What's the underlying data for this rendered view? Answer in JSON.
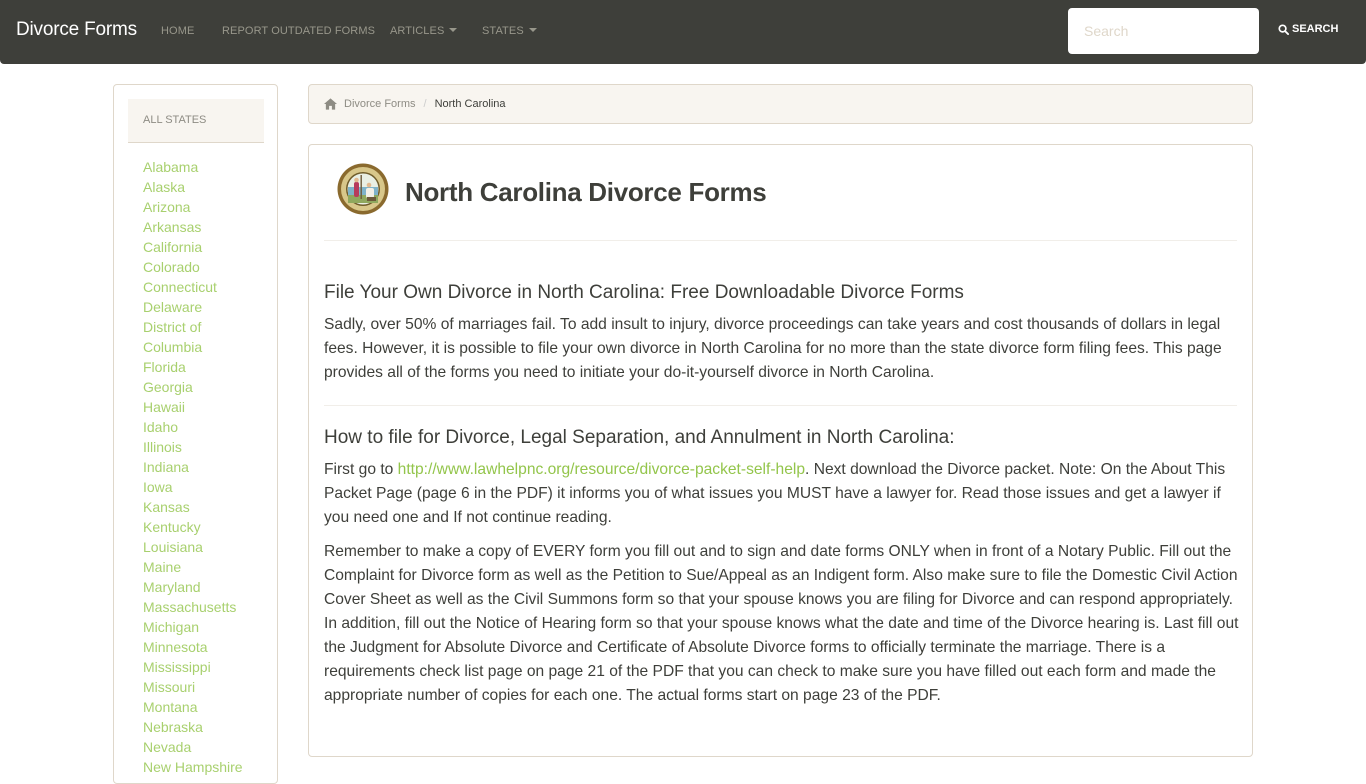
{
  "navbar": {
    "brand": "Divorce Forms",
    "items": [
      {
        "label": "Home",
        "dropdown": false
      },
      {
        "label": "Report Outdated Forms",
        "dropdown": false
      },
      {
        "label": "Articles",
        "dropdown": true
      },
      {
        "label": "States",
        "dropdown": true
      }
    ],
    "search_placeholder": "Search",
    "search_value": "",
    "search_button": "SEARCH",
    "search_icon": "magnifier-icon"
  },
  "sidebar": {
    "heading": "All States",
    "states": [
      "Alabama",
      "Alaska",
      "Arizona",
      "Arkansas",
      "California",
      "Colorado",
      "Connecticut",
      "Delaware",
      "District of",
      "Columbia",
      "Florida",
      "Georgia",
      "Hawaii",
      "Idaho",
      "Illinois",
      "Indiana",
      "Iowa",
      "Kansas",
      "Kentucky",
      "Louisiana",
      "Maine",
      "Maryland",
      "Massachusetts",
      "Michigan",
      "Minnesota",
      "Mississippi",
      "Missouri",
      "Montana",
      "Nebraska",
      "Nevada",
      "New Hampshire"
    ]
  },
  "breadcrumb": {
    "home_icon": "home-icon",
    "link": "Divorce Forms",
    "separator": "/",
    "active": "North Carolina"
  },
  "main": {
    "seal_icon": "state-seal-icon",
    "title": "North Carolina Divorce Forms",
    "section1": {
      "heading": "File Your Own Divorce in North Carolina: Free Downloadable Divorce Forms",
      "body": "Sadly, over 50% of marriages fail. To add insult to injury, divorce proceedings can take years and cost thousands of dollars in legal fees. However, it is possible to file your own divorce in North Carolina for no more than the state divorce form filing fees. This page provides all of the forms you need to initiate your do-it-yourself divorce in North Carolina."
    },
    "section2": {
      "heading": "How to file for Divorce, Legal Separation, and Annulment in North Carolina:",
      "p1_before": "First go to ",
      "p1_link": "http://www.lawhelpnc.org/resource/divorce-packet-self-help",
      "p1_after": ". Next download the Divorce packet. Note: On the About This Packet Page (page 6 in the PDF) it informs you of what issues you MUST have a lawyer for. Read those issues and get a lawyer if you need one and If not continue reading.",
      "p2": "Remember to make a copy of EVERY form you fill out and to sign and date forms ONLY when in front of a Notary Public. Fill out the Complaint for Divorce form as well as the Petition to Sue/Appeal as an Indigent form. Also make sure to file the Domestic Civil Action Cover Sheet as well as the Civil Summons form so that your spouse knows you are filing for Divorce and can respond appropriately. In addition, fill out the Notice of Hearing form so that your spouse knows what the date and time of the Divorce hearing is. Last fill out the Judgment for Absolute Divorce and Certificate of Absolute Divorce forms to officially terminate the marriage. There is a requirements check list page on page 21 of the PDF that you can check to make sure you have filled out each form and made the appropriate number of copies for each one. The actual forms start on page 23 of the PDF."
    }
  }
}
